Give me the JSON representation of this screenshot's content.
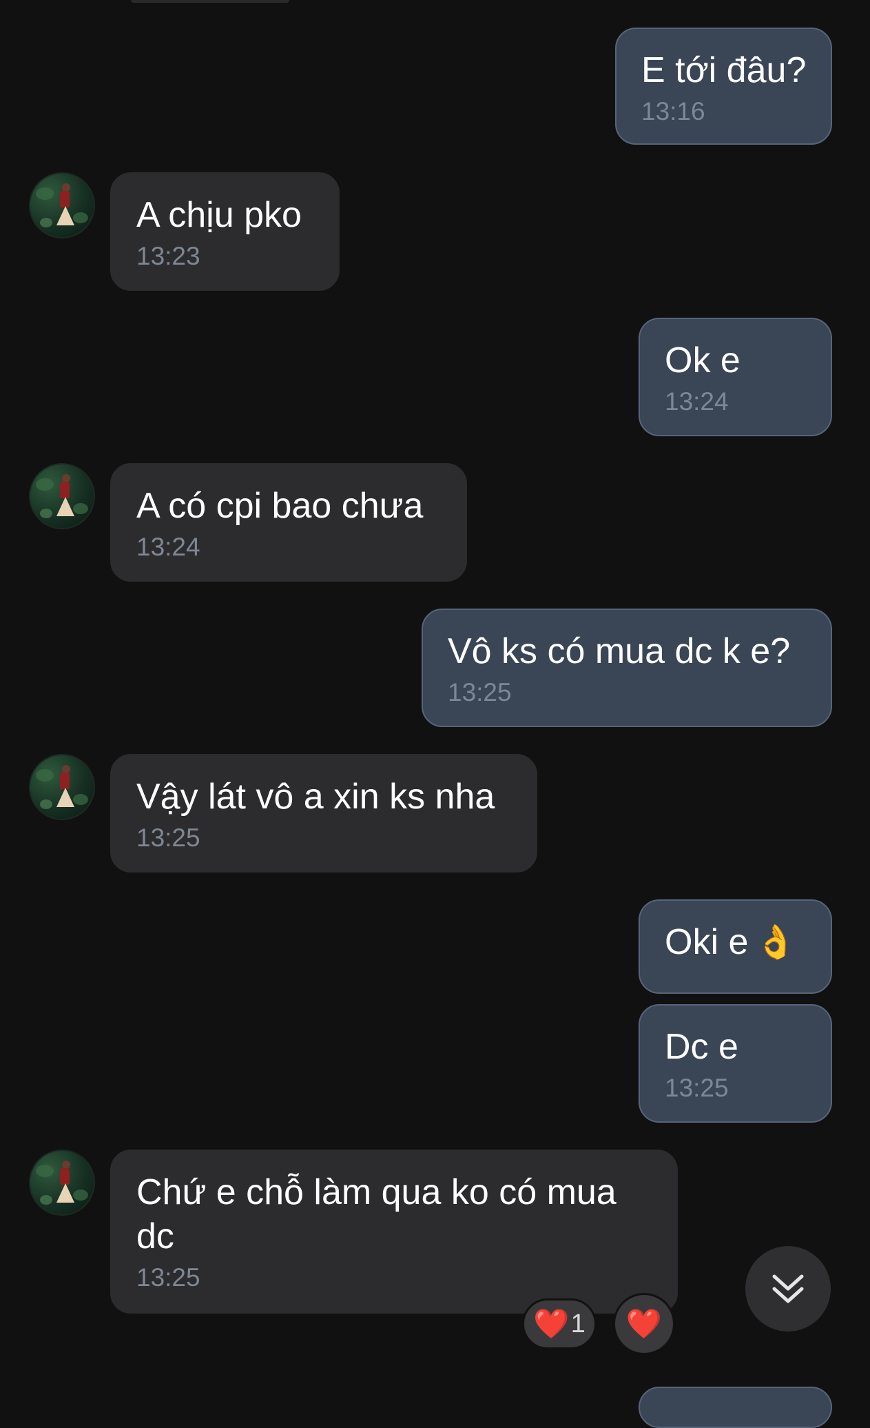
{
  "messages": [
    {
      "side": "sent",
      "text": "E tới đâu?",
      "time": "13:16"
    },
    {
      "side": "recv",
      "text": "A chịu pko",
      "time": "13:23"
    },
    {
      "side": "sent",
      "text": "Ok e",
      "time": "13:24"
    },
    {
      "side": "recv",
      "text": "A có cpi bao chưa",
      "time": "13:24"
    },
    {
      "side": "sent",
      "text": "Vô ks có mua dc k e?",
      "time": "13:25"
    },
    {
      "side": "recv",
      "text": "Vậy lát vô a xin ks nha",
      "time": "13:25"
    },
    {
      "side": "sent",
      "text": "Oki e",
      "emoji": "👌",
      "time": ""
    },
    {
      "side": "sent",
      "text": "Dc e",
      "time": "13:25"
    },
    {
      "side": "recv",
      "text": "Chứ e chỗ làm qua ko có mua\ndc",
      "time": "13:25"
    }
  ],
  "reactions": {
    "heart_count": {
      "icon": "heart-icon",
      "emoji": "❤️",
      "count": "1"
    },
    "add_heart": {
      "icon": "heart-icon",
      "emoji": "❤️"
    }
  },
  "controls": {
    "scroll_down_icon": "double-chevron-down-icon"
  }
}
